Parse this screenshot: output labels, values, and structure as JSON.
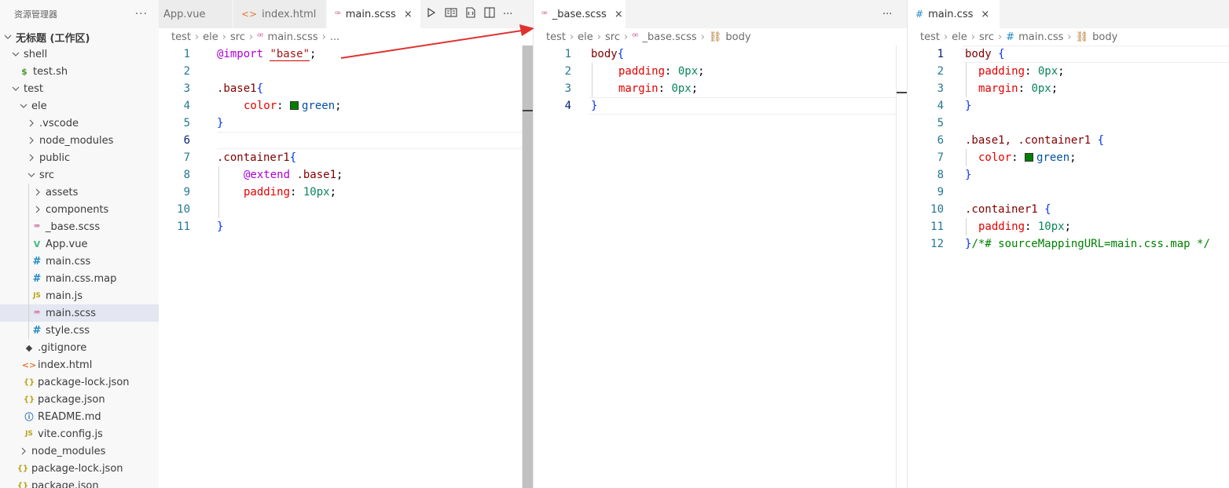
{
  "sidebar": {
    "title": "资源管理器",
    "more": "···",
    "items": [
      {
        "label": "无标题 (工作区)",
        "chev": "v",
        "icon": ""
      },
      {
        "label": "shell",
        "chev": "v",
        "icon": ""
      },
      {
        "label": "test.sh",
        "chev": "",
        "icon": "$"
      },
      {
        "label": "test",
        "chev": "v",
        "icon": ""
      },
      {
        "label": "ele",
        "chev": "v",
        "icon": ""
      },
      {
        "label": ".vscode",
        "chev": ">",
        "icon": ""
      },
      {
        "label": "node_modules",
        "chev": ">",
        "icon": ""
      },
      {
        "label": "public",
        "chev": ">",
        "icon": ""
      },
      {
        "label": "src",
        "chev": "v",
        "icon": ""
      },
      {
        "label": "assets",
        "chev": ">",
        "icon": ""
      },
      {
        "label": "components",
        "chev": ">",
        "icon": ""
      },
      {
        "label": "_base.scss",
        "chev": "",
        "icon": "ꟹ"
      },
      {
        "label": "App.vue",
        "chev": "",
        "icon": "V"
      },
      {
        "label": "main.css",
        "chev": "",
        "icon": "#"
      },
      {
        "label": "main.css.map",
        "chev": "",
        "icon": "#"
      },
      {
        "label": "main.js",
        "chev": "",
        "icon": "JS"
      },
      {
        "label": "main.scss",
        "chev": "",
        "icon": "ꟹ"
      },
      {
        "label": "style.css",
        "chev": "",
        "icon": "#"
      },
      {
        "label": ".gitignore",
        "chev": "",
        "icon": "◆"
      },
      {
        "label": "index.html",
        "chev": "",
        "icon": "<>"
      },
      {
        "label": "package-lock.json",
        "chev": "",
        "icon": "{}"
      },
      {
        "label": "package.json",
        "chev": "",
        "icon": "{}"
      },
      {
        "label": "README.md",
        "chev": "",
        "icon": "ⓘ"
      },
      {
        "label": "vite.config.js",
        "chev": "",
        "icon": "JS"
      },
      {
        "label": "node_modules",
        "chev": ">",
        "icon": ""
      },
      {
        "label": "package-lock.json",
        "chev": "",
        "icon": "{}"
      },
      {
        "label": "package.json",
        "chev": "",
        "icon": "{}"
      }
    ]
  },
  "editor1": {
    "tabs": [
      {
        "label": "App.vue",
        "icon": "V"
      },
      {
        "label": "index.html",
        "icon": "<>"
      },
      {
        "label": "main.scss",
        "icon": "ꟹ",
        "close": "×"
      }
    ],
    "breadcrumb": [
      "test",
      "ele",
      "src",
      "main.scss",
      "..."
    ],
    "line_numbers": [
      "1",
      "2",
      "3",
      "4",
      "5",
      "6",
      "7",
      "8",
      "9",
      "10",
      "11"
    ],
    "code": {
      "l1_at": "@import",
      "l1_str": "\"base\"",
      "l1_end": ";",
      "l3_sel": ".base1",
      "l3_brace": "{",
      "l4_prop": "color",
      "l4_colon": ": ",
      "l4_val": "green",
      "l4_end": ";",
      "l5_brace": "}",
      "l7_sel": ".container1",
      "l7_brace": "{",
      "l8_at": "@extend",
      "l8_sel": " .base1",
      "l8_end": ";",
      "l9_prop": "padding",
      "l9_colon": ": ",
      "l9_num": "10px",
      "l9_end": ";",
      "l11_brace": "}"
    }
  },
  "editor2": {
    "tabs": [
      {
        "label": "_base.scss",
        "icon": "ꟹ",
        "close": "×"
      }
    ],
    "more": "···",
    "breadcrumb": [
      "test",
      "ele",
      "src",
      "_base.scss",
      "body"
    ],
    "line_numbers": [
      "1",
      "2",
      "3",
      "4"
    ],
    "code": {
      "l1_sel": "body",
      "l1_brace": "{",
      "l2_prop": "padding",
      "l2_colon": ": ",
      "l2_num": "0px",
      "l2_end": ";",
      "l3_prop": "margin",
      "l3_colon": ": ",
      "l3_num": "0px",
      "l3_end": ";",
      "l4_brace": "}"
    }
  },
  "editor3": {
    "tabs": [
      {
        "label": "main.css",
        "icon": "#",
        "close": "×"
      }
    ],
    "breadcrumb": [
      "test",
      "ele",
      "src",
      "main.css",
      "body"
    ],
    "line_numbers": [
      "1",
      "2",
      "3",
      "4",
      "5",
      "6",
      "7",
      "8",
      "9",
      "10",
      "11",
      "12"
    ],
    "code": {
      "l1_sel": "body",
      "l1_brace": " {",
      "l2_prop": "padding",
      "l2_colon": ": ",
      "l2_num": "0px",
      "l2_end": ";",
      "l3_prop": "margin",
      "l3_colon": ": ",
      "l3_num": "0px",
      "l3_end": ";",
      "l4_brace": "}",
      "l6_sel": ".base1, .container1",
      "l6_brace": " {",
      "l7_prop": "color",
      "l7_colon": ": ",
      "l7_val": "green",
      "l7_end": ";",
      "l8_brace": "}",
      "l10_sel": ".container1",
      "l10_brace": " {",
      "l11_prop": "padding",
      "l11_colon": ": ",
      "l11_num": "10px",
      "l11_end": ";",
      "l12_brace": "}",
      "l12_cmt": "/*# sourceMappingURL=main.css.map */"
    }
  },
  "colors": {
    "swatch": "#008000",
    "arrow": "#e03131",
    "selected_row": "#e4e6f1"
  }
}
